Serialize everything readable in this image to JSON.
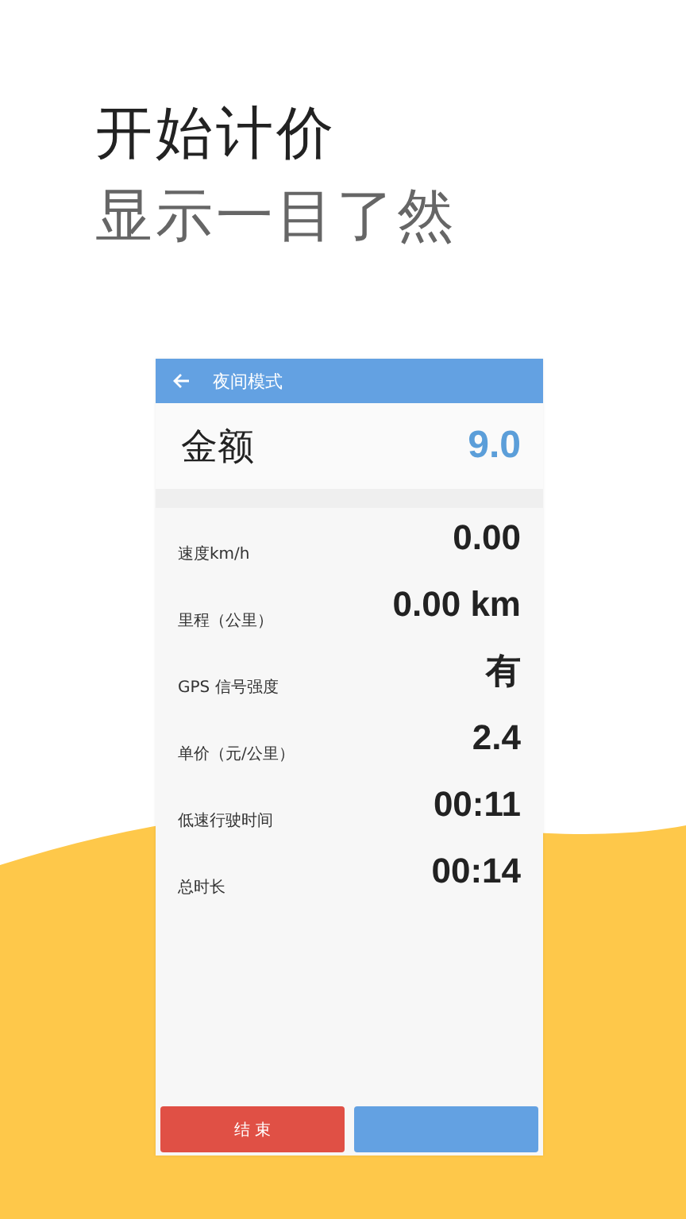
{
  "headline": [
    "开始计价",
    "显示一目了然"
  ],
  "app": {
    "title": "夜间模式",
    "amount_label": "金额",
    "amount_value": "9.0",
    "rows": [
      {
        "label": "速度km/h",
        "value": "0.00"
      },
      {
        "label": "里程（公里）",
        "value": "0.00 km"
      },
      {
        "label": "GPS 信号强度",
        "value": "有"
      },
      {
        "label": "单价（元/公里）",
        "value": "2.4"
      },
      {
        "label": "低速行驶时间",
        "value": "00:11"
      },
      {
        "label": "总时长",
        "value": "00:14"
      }
    ],
    "buttons": [
      {
        "kind": "end",
        "label": "结 束"
      },
      {
        "kind": "other"
      }
    ]
  }
}
